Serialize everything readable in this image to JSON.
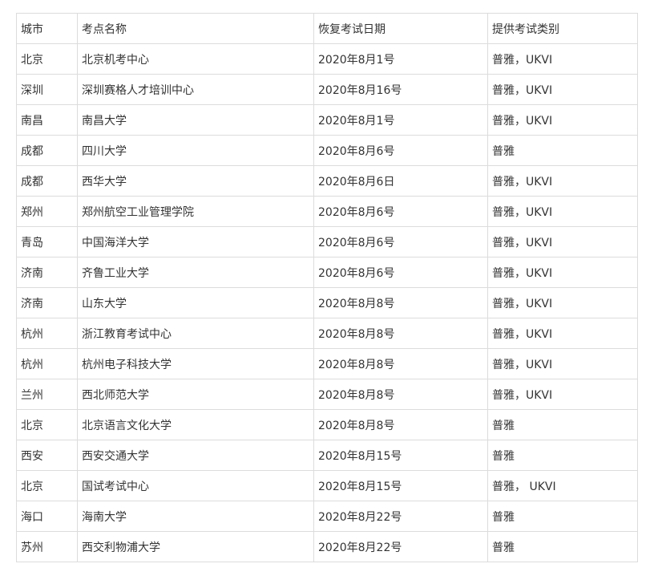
{
  "table": {
    "columns": [
      "城市",
      "考点名称",
      "恢复考试日期",
      "提供考试类别"
    ],
    "rows": [
      [
        "北京",
        "北京机考中心",
        "2020年8月1号",
        "普雅，UKVI"
      ],
      [
        "深圳",
        "深圳赛格人才培训中心",
        "2020年8月16号",
        "普雅，UKVI"
      ],
      [
        "南昌",
        "南昌大学",
        "2020年8月1号",
        "普雅，UKVI"
      ],
      [
        "成都",
        "四川大学",
        "2020年8月6号",
        "普雅"
      ],
      [
        "成都",
        "西华大学",
        "2020年8月6日",
        "普雅，UKVI"
      ],
      [
        "郑州",
        "郑州航空工业管理学院",
        "2020年8月6号",
        "普雅，UKVI"
      ],
      [
        "青岛",
        "中国海洋大学",
        "2020年8月6号",
        "普雅，UKVI"
      ],
      [
        "济南",
        "齐鲁工业大学",
        "2020年8月6号",
        "普雅，UKVI"
      ],
      [
        "济南",
        "山东大学",
        "2020年8月8号",
        "普雅，UKVI"
      ],
      [
        "杭州",
        "浙江教育考试中心",
        "2020年8月8号",
        "普雅，UKVI"
      ],
      [
        "杭州",
        "杭州电子科技大学",
        "2020年8月8号",
        "普雅，UKVI"
      ],
      [
        "兰州",
        "西北师范大学",
        "2020年8月8号",
        "普雅，UKVI"
      ],
      [
        "北京",
        "北京语言文化大学",
        "2020年8月8号",
        "普雅"
      ],
      [
        "西安",
        "西安交通大学",
        "2020年8月15号",
        "普雅"
      ],
      [
        "北京",
        "国试考试中心",
        "2020年8月15号",
        "普雅， UKVI"
      ],
      [
        "海口",
        "海南大学",
        "2020年8月22号",
        "普雅"
      ],
      [
        "苏州",
        "西交利物浦大学",
        "2020年8月22号",
        "普雅"
      ]
    ]
  },
  "colors": {
    "border": "#dcdcdc",
    "text": "#333333",
    "background": "#ffffff"
  }
}
